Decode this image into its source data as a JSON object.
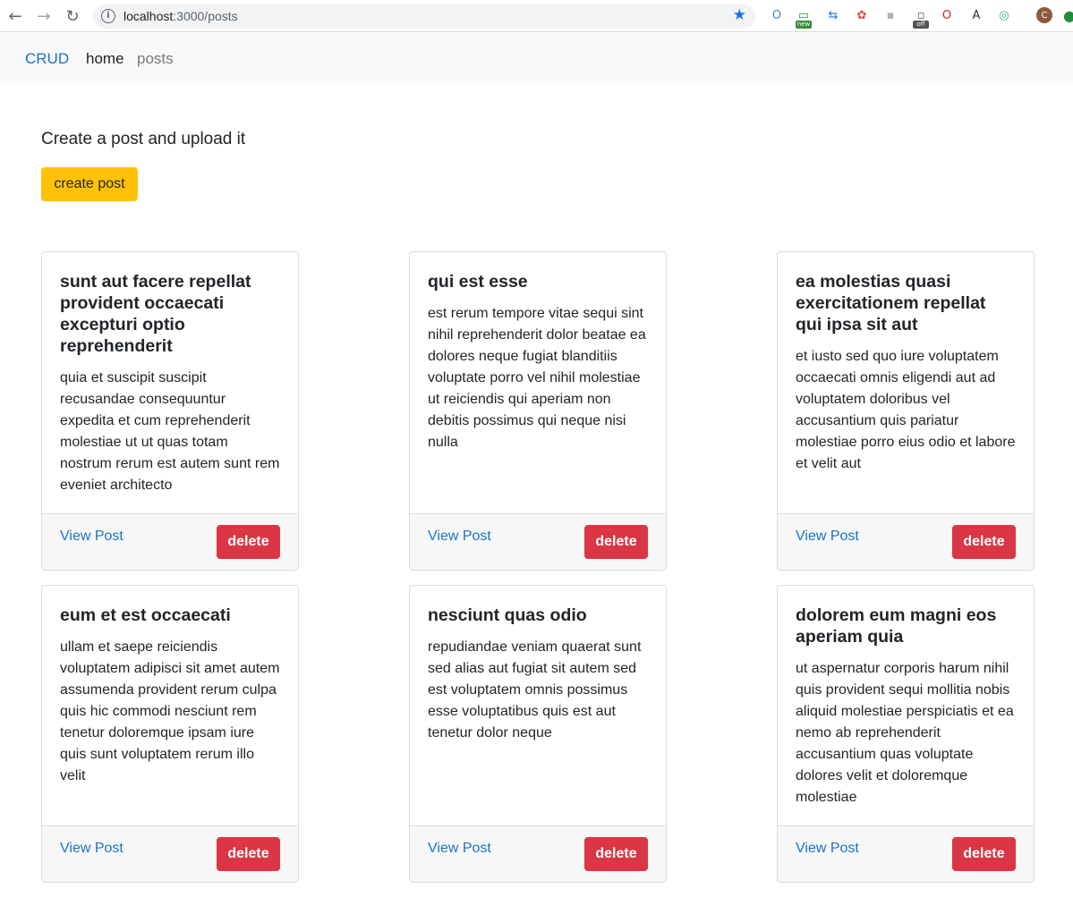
{
  "browser": {
    "back_icon": "←",
    "forward_icon": "→",
    "reload_icon": "↻",
    "url_host": "localhost",
    "url_path": ":3000/posts",
    "info_icon": "i",
    "bookmark_icon": "★",
    "extensions": [
      {
        "name": "ext-opera-icon",
        "glyph": "O",
        "color": "#4a7fd1"
      },
      {
        "name": "ext-new-icon",
        "glyph": "▭",
        "color": "#3c8a3c",
        "badge": "new"
      },
      {
        "name": "ext-arrows-icon",
        "glyph": "⇆",
        "color": "#1a73e8"
      },
      {
        "name": "ext-color-wheel-icon",
        "glyph": "✿",
        "color": "#e0453a"
      },
      {
        "name": "ext-chat-icon",
        "glyph": "▪",
        "color": "#b0b0b0"
      },
      {
        "name": "ext-off-icon",
        "glyph": "▫",
        "color": "#555555",
        "badge": "off"
      },
      {
        "name": "ext-opera-red-icon",
        "glyph": "O",
        "color": "#d02020"
      },
      {
        "name": "ext-a-icon",
        "glyph": "A",
        "color": "#333333"
      },
      {
        "name": "ext-target-icon",
        "glyph": "◎",
        "color": "#2bb673"
      },
      {
        "name": "profile-avatar",
        "glyph": "C",
        "color": "#8d5a3b"
      },
      {
        "name": "ext-green-icon",
        "glyph": "●",
        "color": "#1e8e3e"
      }
    ]
  },
  "navbar": {
    "brand": "CRUD",
    "links": [
      "home",
      "posts"
    ]
  },
  "main": {
    "lead": "Create a post and upload it",
    "create_label": "create post"
  },
  "posts": [
    {
      "title": "sunt aut facere repellat provident occaecati excepturi optio reprehenderit",
      "body": "quia et suscipit suscipit recusandae consequuntur expedita et cum reprehenderit molestiae ut ut quas totam nostrum rerum est autem sunt rem eveniet architecto",
      "view_label": "View Post",
      "delete_label": "delete"
    },
    {
      "title": "qui est esse",
      "body": "est rerum tempore vitae sequi sint nihil reprehenderit dolor beatae ea dolores neque fugiat blanditiis voluptate porro vel nihil molestiae ut reiciendis qui aperiam non debitis possimus qui neque nisi nulla",
      "view_label": "View Post",
      "delete_label": "delete"
    },
    {
      "title": "ea molestias quasi exercitationem repellat qui ipsa sit aut",
      "body": "et iusto sed quo iure voluptatem occaecati omnis eligendi aut ad voluptatem doloribus vel accusantium quis pariatur molestiae porro eius odio et labore et velit aut",
      "view_label": "View Post",
      "delete_label": "delete"
    },
    {
      "title": "eum et est occaecati",
      "body": "ullam et saepe reiciendis voluptatem adipisci sit amet autem assumenda provident rerum culpa quis hic commodi nesciunt rem tenetur doloremque ipsam iure quis sunt voluptatem rerum illo velit",
      "view_label": "View Post",
      "delete_label": "delete"
    },
    {
      "title": "nesciunt quas odio",
      "body": "repudiandae veniam quaerat sunt sed alias aut fugiat sit autem sed est voluptatem omnis possimus esse voluptatibus quis est aut tenetur dolor neque",
      "view_label": "View Post",
      "delete_label": "delete"
    },
    {
      "title": "dolorem eum magni eos aperiam quia",
      "body": "ut aspernatur corporis harum nihil quis provident sequi mollitia nobis aliquid molestiae perspiciatis et ea nemo ab reprehenderit accusantium quas voluptate dolores velit et doloremque molestiae",
      "view_label": "View Post",
      "delete_label": "delete"
    }
  ]
}
